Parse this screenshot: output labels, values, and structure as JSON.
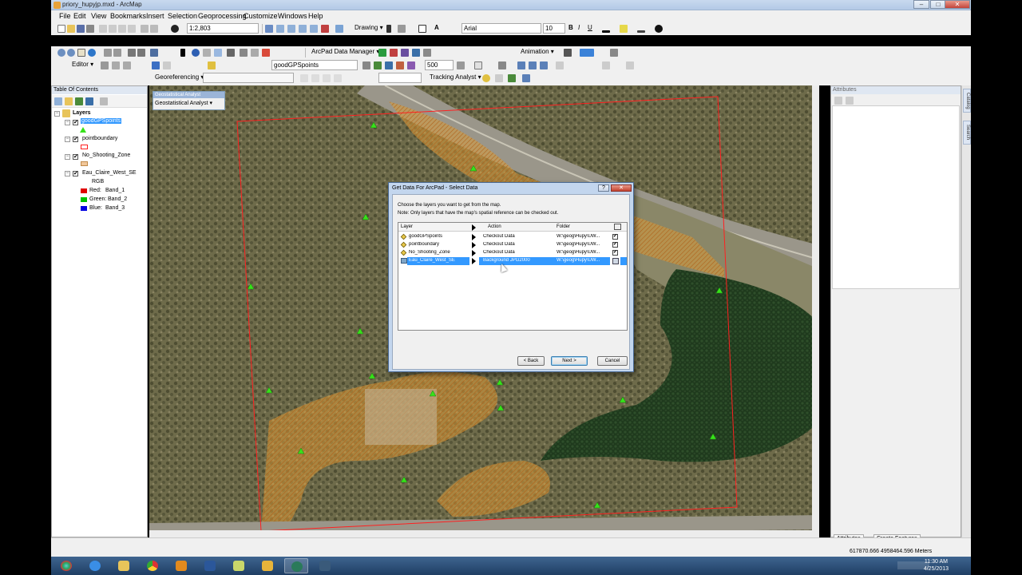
{
  "window": {
    "title": "priory_hupyjp.mxd - ArcMap",
    "minimize": "–",
    "maximize": "□",
    "close": "✕"
  },
  "menu": [
    "File",
    "Edit",
    "View",
    "Bookmarks",
    "Insert",
    "Selection",
    "Geoprocessing",
    "Customize",
    "Windows",
    "Help"
  ],
  "toolbar1": {
    "scale": "1:2,803",
    "drawing_label": "Drawing ▾",
    "font_name": "Arial",
    "font_size": "10",
    "bold": "B",
    "italic": "I",
    "underline": "U",
    "text_tool": "A"
  },
  "toolbar2": {
    "arcpad_label": "ArcPad Data Manager ▾",
    "layer_combo": "goodGPSpoints",
    "distance_value": "500",
    "animation_label": "Animation ▾"
  },
  "toolbar3": {
    "editor_label": "Editor ▾",
    "georef_label": "Georeferencing ▾",
    "tracking_label": "Tracking Analyst ▾"
  },
  "toc": {
    "title": "Table Of Contents",
    "root": "Layers",
    "layers": [
      {
        "name": "goodGPSpoints",
        "checked": "✔",
        "selected": true
      },
      {
        "name": "pointboundary",
        "checked": "✔"
      },
      {
        "name": "No_Shooting_Zone",
        "checked": "✔"
      },
      {
        "name": "Eau_Claire_West_SE",
        "checked": "✔"
      }
    ],
    "rgb_label": "RGB",
    "bands": [
      {
        "label": "Red:",
        "band": "Band_1",
        "color": "#e00000"
      },
      {
        "label": "Green:",
        "band": "Band_2",
        "color": "#00c000"
      },
      {
        "label": "Blue:",
        "band": "Band_3",
        "color": "#0000e0"
      }
    ]
  },
  "geo_toolbar": {
    "caption": "Geostatistical Analyst",
    "label": "Geostatistical Analyst ▾"
  },
  "dialog": {
    "title": "Get Data For ArcPad - Select Data",
    "help": "?",
    "close": "✕",
    "instruction1": "Choose the layers you want to get from the map.",
    "instruction2": "Note: Only layers that have the map's spatial reference can be checked out.",
    "columns": {
      "layer": "Layer",
      "action": "Action",
      "folder": "Folder"
    },
    "rows": [
      {
        "layer": "goodGPSpoints",
        "action": "Checkout Data",
        "folder": "W:\\geog\\Hupy\\UW...",
        "checked": "✔"
      },
      {
        "layer": "pointboundary",
        "action": "Checkout Data",
        "folder": "W:\\geog\\Hupy\\UW...",
        "checked": "✔"
      },
      {
        "layer": "No_Shooting_Zone",
        "action": "Checkout Data",
        "folder": "W:\\geog\\Hupy\\UW...",
        "checked": "✔"
      },
      {
        "layer": "Eau_Claire_West_SE",
        "action": "Background JPG2000",
        "folder": "W:\\geog\\Hupy\\UW...",
        "checked": ""
      }
    ],
    "back": "< Back",
    "next": "Next >",
    "cancel": "Cancel"
  },
  "attributes": {
    "title": "Attributes",
    "tab_attributes": "Attributes",
    "tab_create": "Create Features"
  },
  "side_tabs": [
    "Catalog",
    "Search"
  ],
  "status": {
    "coordinates": "617870.666  4958464.596 Meters"
  },
  "clock": {
    "time": "11:30 AM",
    "date": "4/25/2013"
  },
  "colors": {
    "accent": "#3399ff",
    "no_shooting_fill": "#d99a3a",
    "boundary": "#ff2020",
    "gps_point": "#37e21a"
  }
}
